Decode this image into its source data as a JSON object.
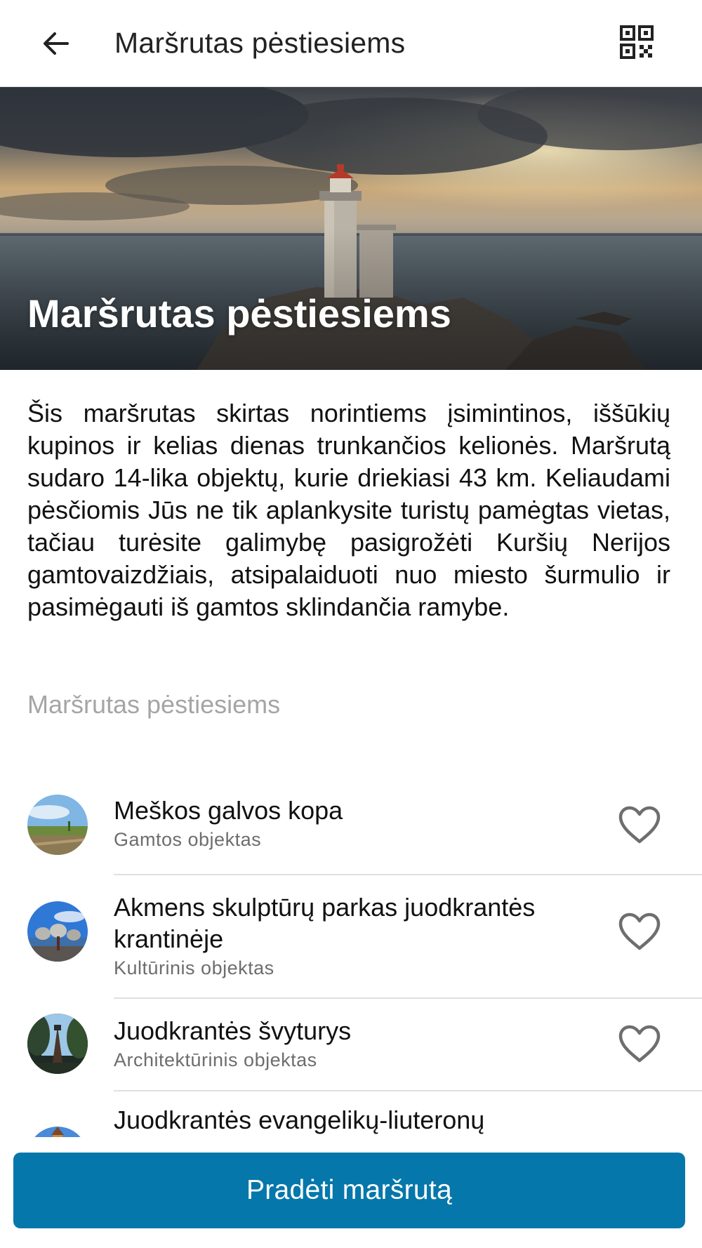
{
  "header": {
    "title": "Maršrutas pėstiesiems",
    "back_icon": "arrow-left-icon",
    "qr_icon": "qr-code-icon"
  },
  "hero": {
    "title": "Maršrutas pėstiesiems",
    "image": "lighthouse-on-rocks-at-sea-under-stormy-sky"
  },
  "description": "Šis maršrutas skirtas norintiems įsimintinos, iššūkių kupinos ir kelias dienas trunkančios kelionės. Maršrutą sudaro 14-lika objektų, kurie driekiasi 43 km. Keliaudami pėsčiomis Jūs ne tik aplankysite turistų pamėgtas vietas, tačiau turėsite galimybę pasigrožėti Kuršių Nerijos gamtovaizdžiais, atsipalaiduoti nuo miesto šurmulio ir pasimėgauti iš gamtos sklindančia ramybe.",
  "section_label": "Maršrutas pėstiesiems",
  "list": {
    "items": [
      {
        "title": "Meškos galvos kopa",
        "subtitle": "Gamtos objektas",
        "thumb": "dune-landscape-thumbnail",
        "favorite_icon": "heart-outline-icon"
      },
      {
        "title": "Akmens skulptūrų parkas juodkrantės krantinėje",
        "subtitle": "Kultūrinis objektas",
        "thumb": "stone-sculptures-thumbnail",
        "favorite_icon": "heart-outline-icon"
      },
      {
        "title": "Juodkrantės švyturys",
        "subtitle": "Architektūrinis objektas",
        "thumb": "lighthouse-tower-thumbnail",
        "favorite_icon": "heart-outline-icon"
      },
      {
        "title": "Juodkrantės evangelikų-liuteronų",
        "subtitle": "",
        "thumb": "church-thumbnail",
        "favorite_icon": "heart-outline-icon"
      }
    ]
  },
  "action": {
    "start_label": "Pradėti maršrutą"
  },
  "colors": {
    "primary_button": "#0677aa",
    "subtitle_gray": "#6d6d6d",
    "section_label_gray": "#a5a5a5"
  }
}
